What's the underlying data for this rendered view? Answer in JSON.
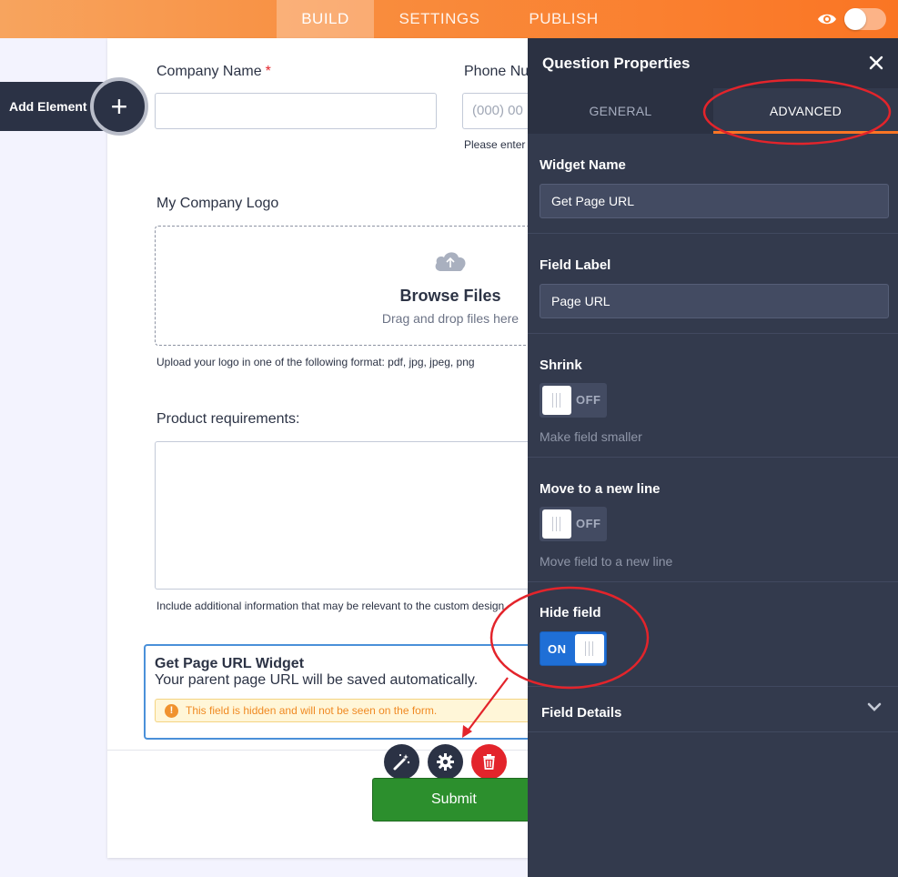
{
  "topbar": {
    "tabs": [
      {
        "label": "BUILD"
      },
      {
        "label": "SETTINGS"
      },
      {
        "label": "PUBLISH"
      }
    ]
  },
  "sidebar": {
    "add_element_label": "Add Element"
  },
  "form": {
    "company_name_label": "Company Name",
    "required_mark": "*",
    "phone_label": "Phone Nu",
    "phone_placeholder": "(000) 00",
    "phone_hint": "Please enter",
    "logo_label": "My Company Logo",
    "browse_title": "Browse Files",
    "browse_sub": "Drag and drop files here",
    "logo_hint": "Upload your logo in one of the following format: pdf, jpg, jpeg, png",
    "requirements_label": "Product requirements:",
    "requirements_hint": "Include additional information that may be relevant to the custom design",
    "widget_title": "Get Page URL Widget",
    "widget_desc": "Your parent page URL will be saved automatically.",
    "widget_warning": "This field is hidden and will not be seen on the form.",
    "warning_icon": "!",
    "submit_label": "Submit"
  },
  "panel": {
    "title": "Question Properties",
    "tabs": [
      {
        "label": "GENERAL"
      },
      {
        "label": "ADVANCED"
      }
    ],
    "widget_name": {
      "label": "Widget Name",
      "value": "Get Page URL"
    },
    "field_label": {
      "label": "Field Label",
      "value": "Page URL"
    },
    "shrink": {
      "label": "Shrink",
      "state": "OFF",
      "hint": "Make field smaller"
    },
    "new_line": {
      "label": "Move to a new line",
      "state": "OFF",
      "hint": "Move field to a new line"
    },
    "hide_field": {
      "label": "Hide field",
      "state": "ON"
    },
    "field_details": {
      "label": "Field Details"
    }
  },
  "colors": {
    "accent": "#fa7524",
    "panel_bg": "#333a4d",
    "toggle_on": "#1f6fd6",
    "annotation": "#e3242b"
  }
}
